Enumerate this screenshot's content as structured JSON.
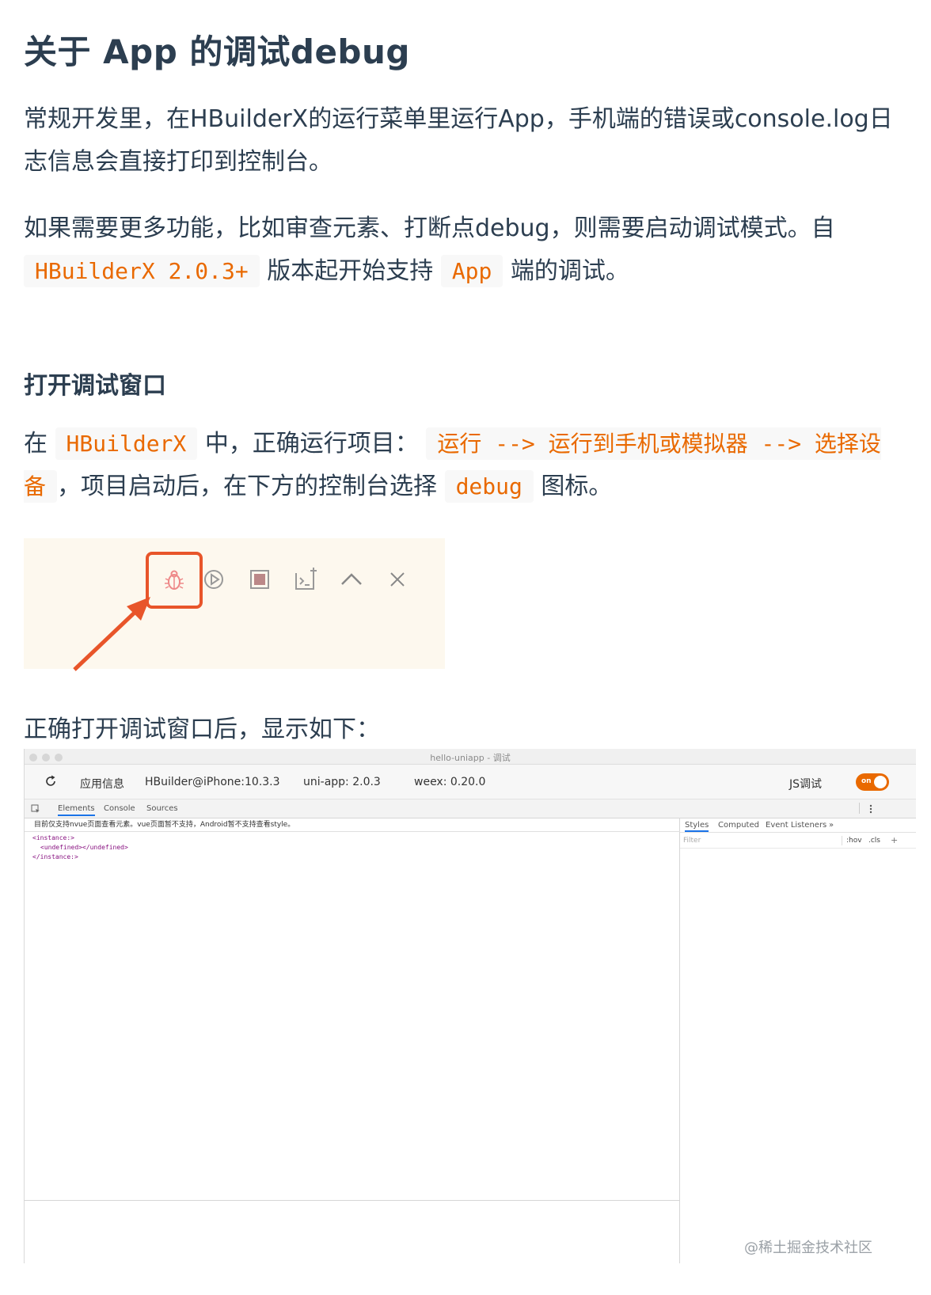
{
  "article": {
    "title": "关于 App 的调试debug",
    "p1": {
      "text": "常规开发里，在HBuilderX的运行菜单里运行App，手机端的错误或console.log日志信息会直接打印到控制台。"
    },
    "p2": {
      "text_a": "如果需要更多功能，比如审查元素、打断点debug，则需要启动调试模式。自",
      "code_a": "HBuilderX 2.0.3+",
      "text_b": "版本起开始支持",
      "code_b": "App",
      "text_c": "端的调试。"
    },
    "h_open": "打开调试窗口",
    "p3": {
      "text_a": "在",
      "code_a": "HBuilderX",
      "text_b": "中，正确运行项目：",
      "code_b": "运行 --> 运行到手机或模拟器 --> 选择设备",
      "text_c": "，项目启动后，在下方的控制台选择",
      "code_c": "debug",
      "text_d": "图标。"
    },
    "p4": {
      "text": "正确打开调试窗口后，显示如下："
    }
  },
  "debugger": {
    "window_title": "hello-uniapp - 调试",
    "info": {
      "app_info_label": "应用信息",
      "device": "HBuilder@iPhone:10.3.3",
      "uniapp": "uni-app: 2.0.3",
      "weex": "weex: 0.20.0",
      "js_debug_label": "JS调试",
      "toggle_text": "on"
    },
    "tabs": [
      "Elements",
      "Console",
      "Sources"
    ],
    "warning": "目前仅支持nvue页面查看元素。vue页面暂不支持，Android暂不支持查看style。",
    "xml": {
      "line1": "<instance:>",
      "line2_open": "<undefined>",
      "line2_close": "</undefined>",
      "line3": "</instance:>"
    },
    "right_tabs": [
      "Styles",
      "Computed",
      "Event Listeners",
      "»"
    ],
    "filter_placeholder": "Filter",
    "filter_hov": ":hov",
    "filter_cls": ".cls",
    "filter_plus": "+"
  },
  "watermark": "@稀土掘金技术社区",
  "colors": {
    "text": "#2c3e50",
    "code": "#e96900",
    "code_bg": "#f8f8f8",
    "highlight_box": "#e8552a",
    "toolbar_bg": "#fdf8ee"
  }
}
